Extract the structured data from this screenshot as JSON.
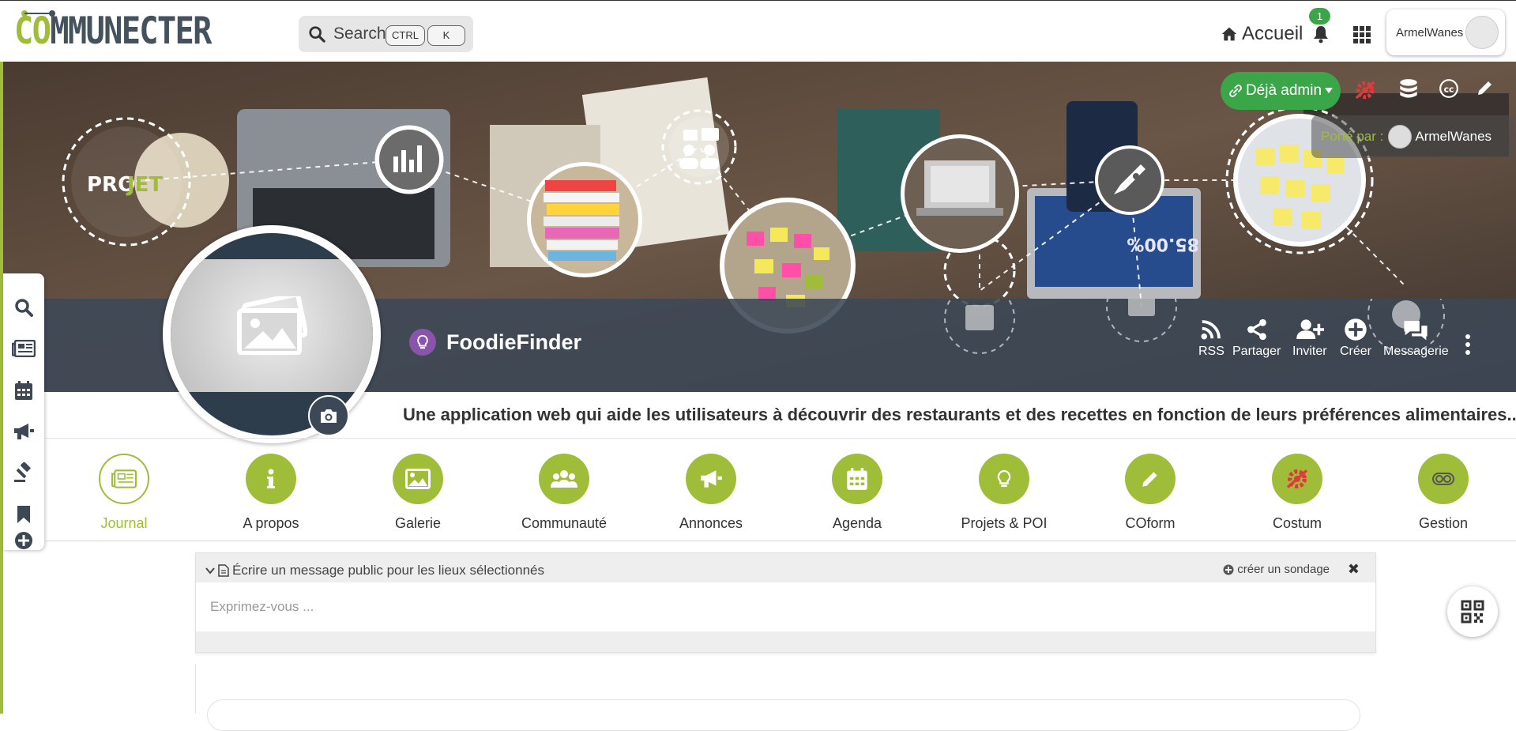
{
  "header": {
    "logo_prefix": "CO",
    "logo_rest": "MMUNECTER",
    "search_label": "Search",
    "kbd_ctrl": "CTRL",
    "kbd_k": "K",
    "home_label": "Accueil",
    "notif_count": "1",
    "user_name": "ArmelWanes"
  },
  "banner": {
    "admin_label": "Déjà admin",
    "porte_label": "Porté par :",
    "porte_user": "ArmelWanes",
    "projet_badge": "PRO",
    "projet_badge_accent": "JET",
    "stat_text": "85.00%",
    "project_name": "FoodieFinder",
    "actions": [
      {
        "label": "RSS",
        "icon": "rss-icon"
      },
      {
        "label": "Partager",
        "icon": "share-icon"
      },
      {
        "label": "Inviter",
        "icon": "user-plus-icon"
      },
      {
        "label": "Créer",
        "icon": "plus-circle-icon"
      },
      {
        "label": "Messagerie",
        "icon": "comments-icon"
      }
    ]
  },
  "description": "Une application web qui aide les utilisateurs à découvrir des restaurants et des recettes en fonction de leurs préférences alimentaires....",
  "tabs": [
    {
      "label": "Journal",
      "icon": "newspaper-icon",
      "active": true
    },
    {
      "label": "A propos",
      "icon": "info-icon"
    },
    {
      "label": "Galerie",
      "icon": "image-icon"
    },
    {
      "label": "Communauté",
      "icon": "users-icon"
    },
    {
      "label": "Annonces",
      "icon": "bullhorn-icon"
    },
    {
      "label": "Agenda",
      "icon": "calendar-icon"
    },
    {
      "label": "Projets & POI",
      "icon": "lightbulb-icon"
    },
    {
      "label": "COform",
      "icon": "pencil-icon"
    },
    {
      "label": "Costum",
      "icon": "costum-icon"
    },
    {
      "label": "Gestion",
      "icon": "toggle-icon"
    }
  ],
  "sidebar": [
    "search-icon",
    "newspaper-icon",
    "calendar-icon",
    "bullhorn-icon",
    "gavel-icon",
    "bookmark-icon",
    "plus-circle-icon"
  ],
  "composer": {
    "title": "Écrire un message public pour les lieux sélectionnés",
    "poll_label": "créer un sondage",
    "close_label": "✖",
    "placeholder": "Exprimez-vous ..."
  },
  "colors": {
    "brand_green": "#9fbd38",
    "admin_green": "#3aa647",
    "strip": "#3c4856",
    "project_purple": "#8a54ab"
  }
}
